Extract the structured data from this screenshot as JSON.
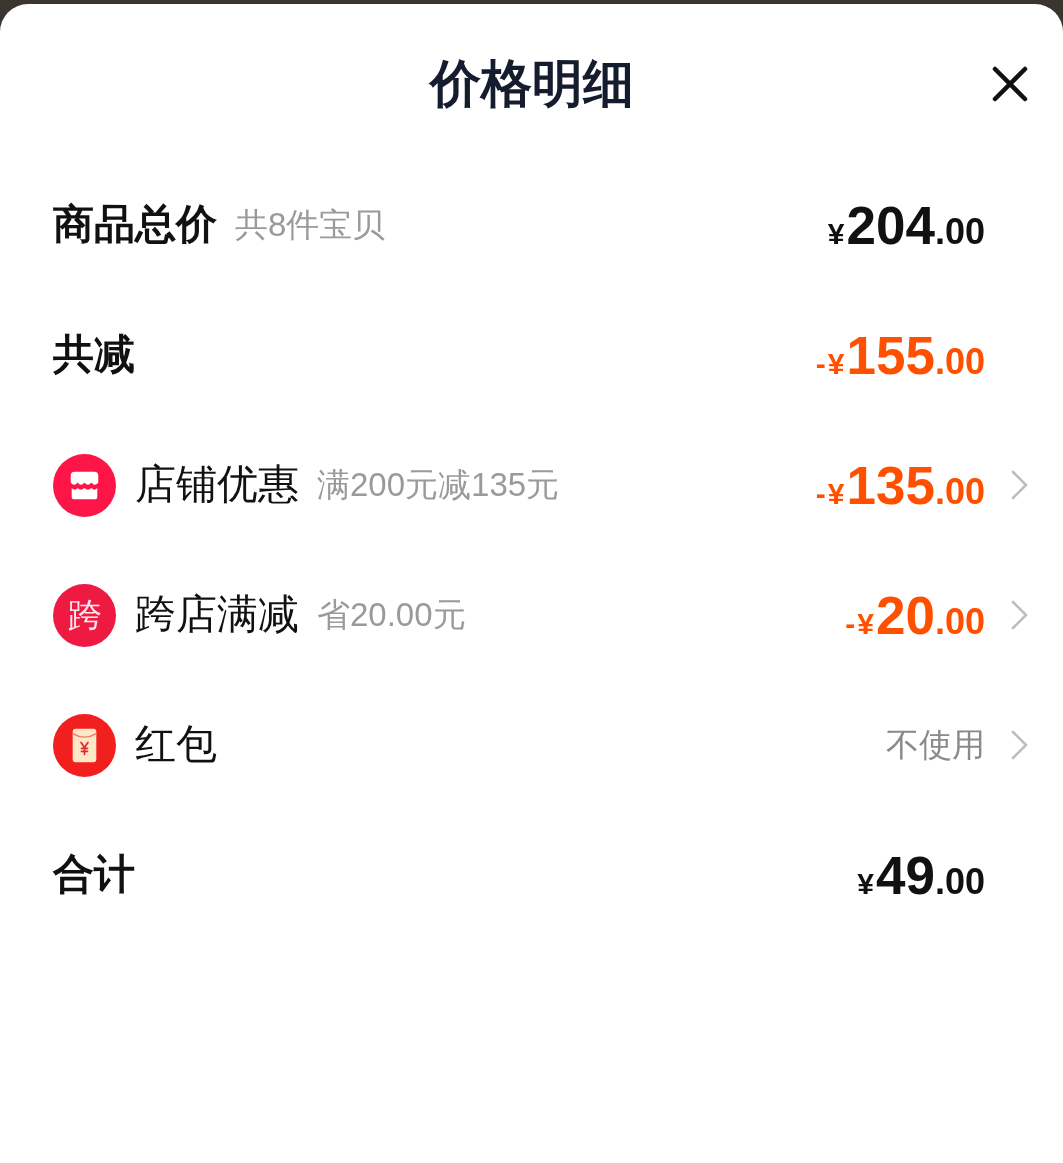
{
  "sheet": {
    "title": "价格明细"
  },
  "rows": [
    {
      "kind": "summary",
      "label": "商品总价",
      "note": "共8件宝贝",
      "amount": {
        "prefix": "¥",
        "integer": "204",
        "fraction": ".00"
      },
      "highlight": false
    },
    {
      "kind": "summary",
      "label": "共减",
      "amount": {
        "prefix": "-¥",
        "integer": "155",
        "fraction": ".00"
      },
      "highlight": true
    },
    {
      "kind": "store",
      "label": "店铺优惠",
      "note": "满200元减135元",
      "amount": {
        "prefix": "-¥",
        "integer": "135",
        "fraction": ".00"
      },
      "highlight": true
    },
    {
      "kind": "badge",
      "badge": "跨",
      "label": "跨店满减",
      "note": "省20.00元",
      "amount": {
        "prefix": "-¥",
        "integer": "20",
        "fraction": ".00"
      },
      "highlight": true
    },
    {
      "kind": "packet",
      "label": "红包",
      "value": "不使用"
    },
    {
      "kind": "summary",
      "label": "合计",
      "amount": {
        "prefix": "¥",
        "integer": "49",
        "fraction": ".00"
      },
      "highlight": false
    }
  ]
}
